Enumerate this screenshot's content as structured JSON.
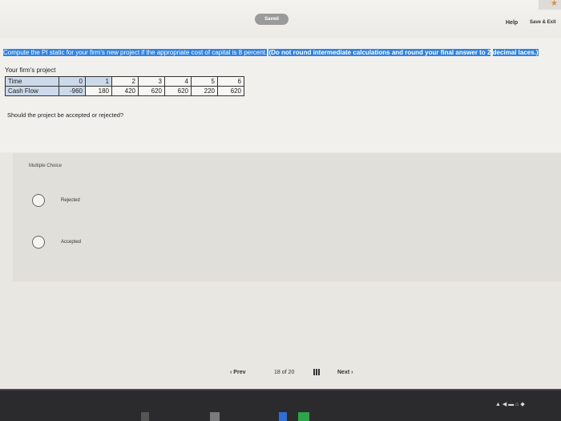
{
  "header": {
    "saved": "Saved",
    "help": "Help",
    "save_exit": "Save & Exit"
  },
  "prompt": {
    "text_a": "Compute the PI static for your firm's new project if the appropriate cost of capital is 8 percent.",
    "text_b": "(Do not round intermediate calculations and round your final answer to 2",
    "text_c": "decimal laces.)"
  },
  "table": {
    "title": "Your firm's project",
    "row_labels": [
      "Time",
      "Cash Flow"
    ],
    "time": [
      "0",
      "1",
      "2",
      "3",
      "4",
      "5",
      "6"
    ],
    "cash_flow": [
      "-960",
      "180",
      "420",
      "620",
      "620",
      "220",
      "620"
    ]
  },
  "question": "Should the project be accepted or rejected?",
  "choices": {
    "label": "Multiple Choice",
    "options": [
      "Rejected",
      "Accepted"
    ]
  },
  "pagination": {
    "prev": "Prev",
    "current": "18",
    "of": "of",
    "total": "20",
    "next": "Next"
  },
  "colors": {
    "highlight": "#2f82e0",
    "background": "#e9e7e2"
  }
}
